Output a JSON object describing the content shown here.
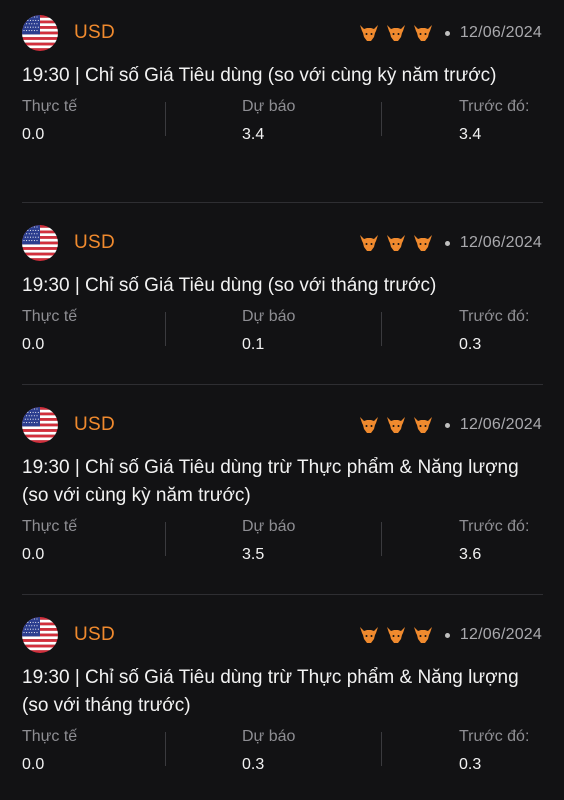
{
  "colors": {
    "background": "#121214",
    "accent": "#f08a2e",
    "label": "#8e8e93",
    "text": "#f2f2f2"
  },
  "events": [
    {
      "currency": "USD",
      "flag_icon": "us-flag-icon",
      "impact_icon": "bull-icon",
      "impact_level": 3,
      "date": "12/06/2024",
      "title": "19:30 | Chỉ số Giá Tiêu dùng (so với cùng kỳ năm trước)",
      "actual_label": "Thực tế",
      "actual": "0.0",
      "forecast_label": "Dự báo",
      "forecast": "3.4",
      "previous_label": "Trước đó:",
      "previous": "3.4"
    },
    {
      "currency": "USD",
      "flag_icon": "us-flag-icon",
      "impact_icon": "bull-icon",
      "impact_level": 3,
      "date": "12/06/2024",
      "title": "19:30 | Chỉ số Giá Tiêu dùng (so với tháng trước)",
      "actual_label": "Thực tế",
      "actual": "0.0",
      "forecast_label": "Dự báo",
      "forecast": "0.1",
      "previous_label": "Trước đó:",
      "previous": "0.3"
    },
    {
      "currency": "USD",
      "flag_icon": "us-flag-icon",
      "impact_icon": "bull-icon",
      "impact_level": 3,
      "date": "12/06/2024",
      "title": "19:30 | Chỉ số Giá Tiêu dùng trừ Thực phẩm & Năng lượng (so với cùng kỳ năm trước)",
      "actual_label": "Thực tế",
      "actual": "0.0",
      "forecast_label": "Dự báo",
      "forecast": "3.5",
      "previous_label": "Trước đó:",
      "previous": "3.6"
    },
    {
      "currency": "USD",
      "flag_icon": "us-flag-icon",
      "impact_icon": "bull-icon",
      "impact_level": 3,
      "date": "12/06/2024",
      "title": "19:30 | Chỉ số Giá Tiêu dùng trừ Thực phẩm & Năng lượng (so với tháng trước)",
      "actual_label": "Thực tế",
      "actual": "0.0",
      "forecast_label": "Dự báo",
      "forecast": "0.3",
      "previous_label": "Trước đó:",
      "previous": "0.3"
    }
  ]
}
